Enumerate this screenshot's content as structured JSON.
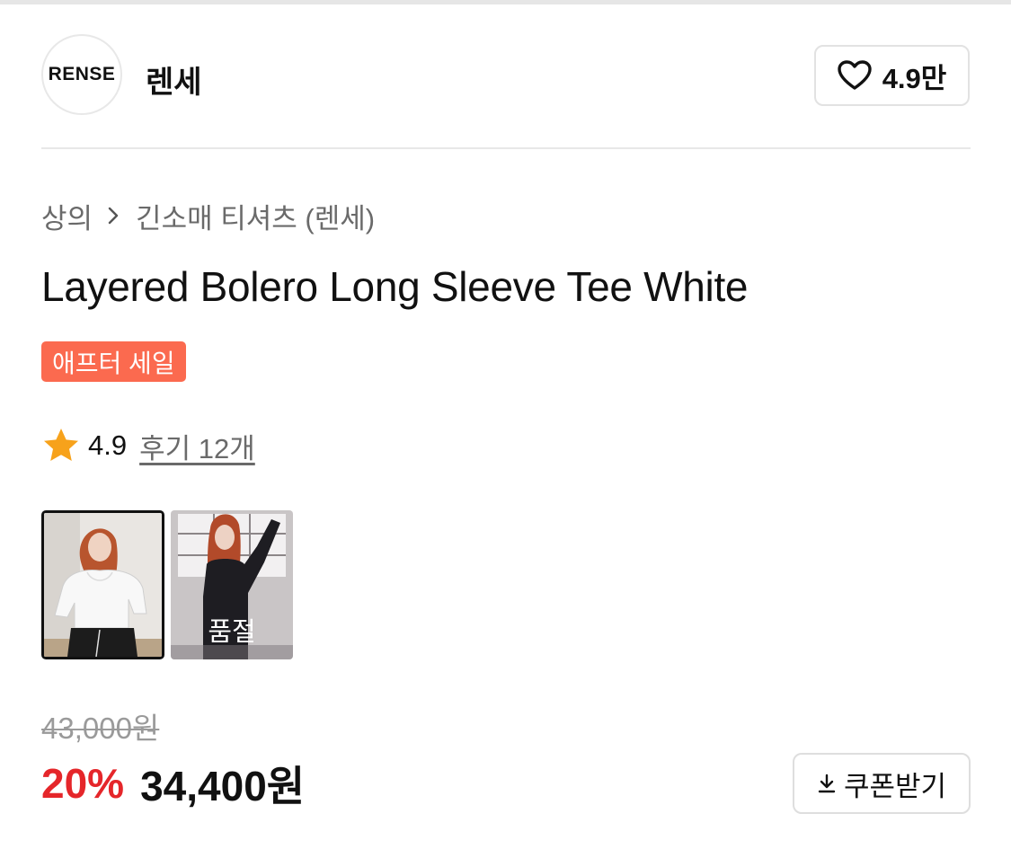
{
  "brand": {
    "logo_text": "RENSE",
    "name": "렌세",
    "like_count": "4.9만"
  },
  "breadcrumb": {
    "category": "상의",
    "subcategory": "긴소매 티셔츠 (렌세)"
  },
  "product": {
    "title": "Layered Bolero Long Sleeve Tee White",
    "badge": "애프터 세일",
    "rating": "4.9",
    "review_link": "후기 12개"
  },
  "thumbnails": [
    {
      "icon": "white-tee-model-photo",
      "selected": true
    },
    {
      "icon": "black-tee-model-photo",
      "label": "품절"
    }
  ],
  "price": {
    "original": "43,000원",
    "discount": "20%",
    "sale": "34,400원"
  },
  "coupon": {
    "label": "쿠폰받기",
    "icon": "download-icon"
  },
  "colors": {
    "badge": "#fb6a4f",
    "discount": "#e5262a",
    "star": "#f7a21b"
  }
}
